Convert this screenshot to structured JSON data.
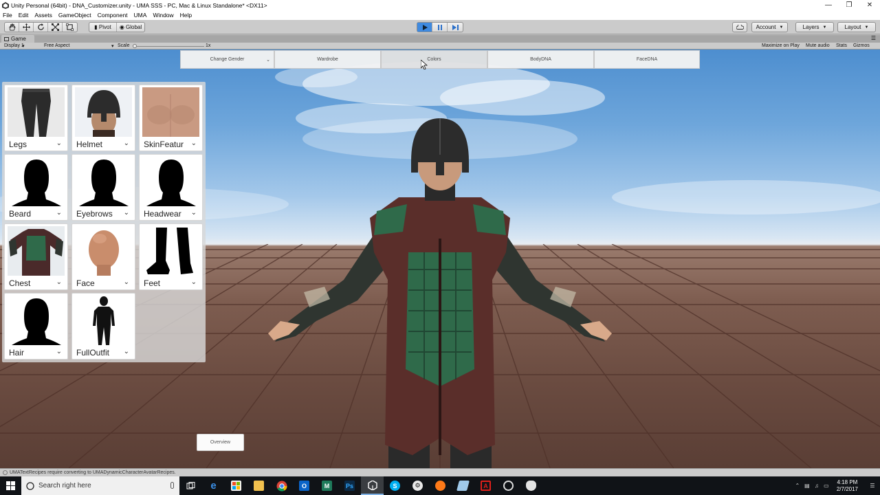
{
  "window": {
    "title": "Unity Personal (64bit) - DNA_Customizer.unity - UMA SSS - PC, Mac & Linux Standalone* <DX11>",
    "controls": [
      "minimize",
      "restore",
      "close"
    ]
  },
  "menu": [
    "File",
    "Edit",
    "Assets",
    "GameObject",
    "Component",
    "UMA",
    "Window",
    "Help"
  ],
  "toolbar": {
    "tools": [
      "hand-tool",
      "move-tool",
      "rotate-tool",
      "scale-tool",
      "rect-tool"
    ],
    "pivot_label": "Pivot",
    "global_label": "Global",
    "play_icons": [
      "play",
      "pause",
      "step"
    ],
    "account_label": "Account",
    "layers_label": "Layers",
    "layout_label": "Layout"
  },
  "game_tab": {
    "label": "Game",
    "display": "Display 1",
    "aspect": "Free Aspect",
    "scale_label": "Scale",
    "scale_value": "1x",
    "options": [
      "Maximize on Play",
      "Mute audio",
      "Stats",
      "Gizmos"
    ]
  },
  "top_tabs": [
    {
      "label": "Change Gender",
      "dropdown": true
    },
    {
      "label": "Wardrobe"
    },
    {
      "label": "Colors",
      "active": true
    },
    {
      "label": "BodyDNA"
    },
    {
      "label": "FaceDNA"
    }
  ],
  "wardrobe_slots": [
    {
      "label": "Legs",
      "thumb": "legs"
    },
    {
      "label": "Helmet",
      "thumb": "helmet"
    },
    {
      "label": "SkinFeatur",
      "thumb": "skin"
    },
    {
      "label": "Beard",
      "thumb": "head-silhouette"
    },
    {
      "label": "Eyebrows",
      "thumb": "head-silhouette"
    },
    {
      "label": "Headwear",
      "thumb": "head-silhouette"
    },
    {
      "label": "Chest",
      "thumb": "chest"
    },
    {
      "label": "Face",
      "thumb": "face"
    },
    {
      "label": "Feet",
      "thumb": "feet"
    },
    {
      "label": "Hair",
      "thumb": "head-silhouette"
    },
    {
      "label": "FullOutfit",
      "thumb": "outfit"
    }
  ],
  "overview_label": "Overview",
  "status_message": "UMATextRecipes require converting to UMADynamicCharacterAvatarRecipes.",
  "taskbar": {
    "search_placeholder": "Search right here",
    "apps": [
      "task-view",
      "edge",
      "store",
      "file-explorer",
      "chrome",
      "outlook",
      "m-app",
      "photoshop",
      "unity",
      "skype",
      "steam",
      "firefox",
      "misc-app",
      "acrobat",
      "app-circle",
      "app-shield"
    ],
    "time": "4:18 PM",
    "date": "2/7/2017"
  },
  "colors": {
    "accent": "#3f8ae0",
    "floor": "#7e5d50",
    "sky": "#6ea6db"
  }
}
